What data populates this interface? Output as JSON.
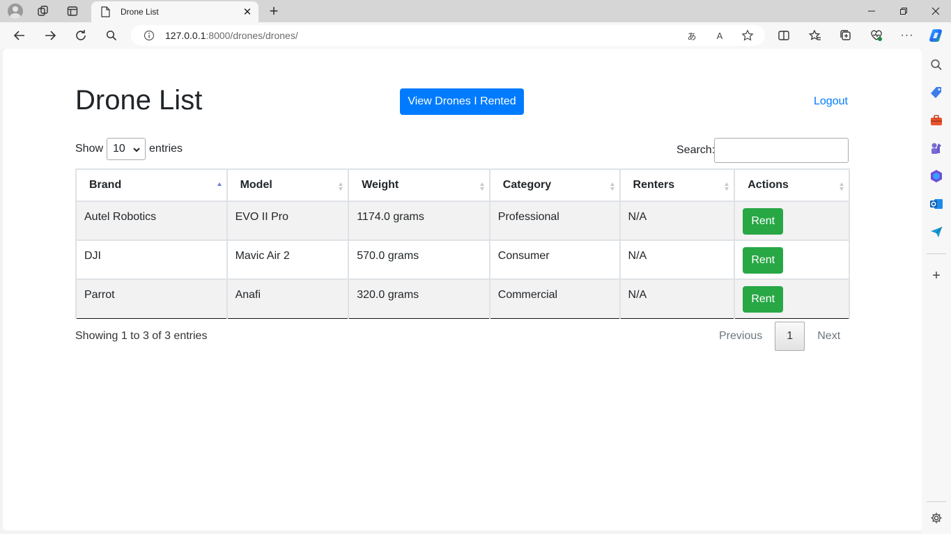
{
  "browser": {
    "tab_title": "Drone List",
    "url_host": "127.0.0.1",
    "url_path": ":8000/drones/drones/",
    "translate_glyph": "あ",
    "readaloud_glyph": "A",
    "more_glyph": "···",
    "new_tab_glyph": "+",
    "tab_close_glyph": "✕",
    "sidebar_add_glyph": "+"
  },
  "page": {
    "title": "Drone List",
    "rented_button": "View Drones I Rented",
    "logout": "Logout"
  },
  "controls": {
    "show_label": "Show",
    "entries_label": "entries",
    "page_length": "10",
    "search_label": "Search:",
    "search_value": ""
  },
  "table": {
    "headers": [
      "Brand",
      "Model",
      "Weight",
      "Category",
      "Renters",
      "Actions"
    ],
    "sorted_column": "Brand",
    "sort_direction": "ascending",
    "rows": [
      {
        "brand": "Autel Robotics",
        "model": "EVO II Pro",
        "weight": "1174.0 grams",
        "category": "Professional",
        "renters": "N/A",
        "action": "Rent"
      },
      {
        "brand": "DJI",
        "model": "Mavic Air 2",
        "weight": "570.0 grams",
        "category": "Consumer",
        "renters": "N/A",
        "action": "Rent"
      },
      {
        "brand": "Parrot",
        "model": "Anafi",
        "weight": "320.0 grams",
        "category": "Commercial",
        "renters": "N/A",
        "action": "Rent"
      }
    ]
  },
  "footer": {
    "info": "Showing 1 to 3 of 3 entries",
    "previous": "Previous",
    "current_page": "1",
    "next": "Next"
  },
  "colors": {
    "primary": "#007bff",
    "success": "#28a745",
    "link": "#007bff"
  }
}
